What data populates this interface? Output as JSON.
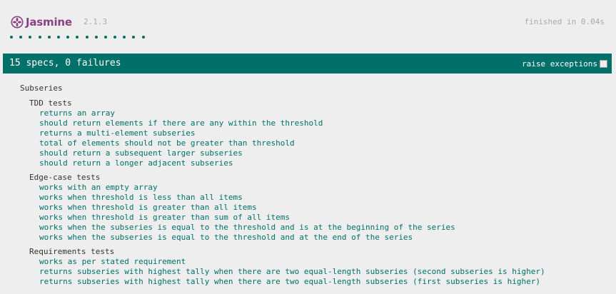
{
  "header": {
    "logo_text": "Jasmine",
    "logo_icon": "jasmine-flower-icon",
    "version": "2.1.3",
    "duration": "finished in 0.04s"
  },
  "progress": {
    "passed_dots": 15,
    "dot_color": "#007069"
  },
  "summary": {
    "text": "15 specs, 0 failures",
    "raise_exceptions_label": "raise exceptions",
    "raise_exceptions_checked": false,
    "bar_color": "#007069"
  },
  "results": {
    "suite": "Subseries",
    "groups": [
      {
        "title": "TDD tests",
        "specs": [
          "returns an array",
          "should return elements if there are any within the threshold",
          "returns a multi-element subseries",
          "total of elements should not be greater than threshold",
          "should return a subsequent larger subseries",
          "should return a longer adjacent subseries"
        ]
      },
      {
        "title": "Edge-case tests",
        "specs": [
          "works with an empty array",
          "works when threshold is less than all items",
          "works when threshold is greater than all items",
          "works when threshold is greater than sum of all items",
          "works when the subseries is equal to the threshold and is at the beginning of the series",
          "works when the subseries is equal to the threshold and at the end of the series"
        ]
      },
      {
        "title": "Requirements tests",
        "specs": [
          "works as per stated requirement",
          "returns subseries with highest tally when there are two equal-length subseries (second subseries is higher)",
          "returns subseries with highest tally when there are two equal-length subseries (first subseries is higher)"
        ]
      }
    ]
  }
}
